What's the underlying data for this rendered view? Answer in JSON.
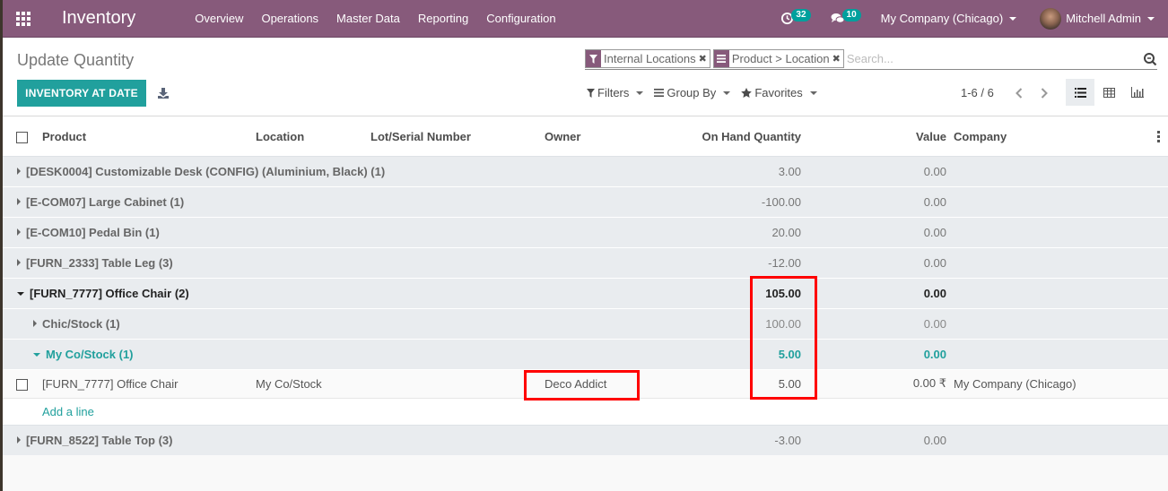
{
  "navbar": {
    "brand": "Inventory",
    "menu": [
      "Overview",
      "Operations",
      "Master Data",
      "Reporting",
      "Configuration"
    ],
    "activities_count": "32",
    "messages_count": "10",
    "company": "My Company (Chicago)",
    "user": "Mitchell Admin"
  },
  "control_panel": {
    "breadcrumb": "Update Quantity",
    "primary_button": "INVENTORY AT DATE",
    "facets": [
      {
        "type": "filter",
        "label": "Internal Locations"
      },
      {
        "type": "groupby",
        "label": "Product > Location"
      }
    ],
    "search_placeholder": "Search...",
    "filters_label": "Filters",
    "groupby_label": "Group By",
    "favorites_label": "Favorites",
    "pager": "1-6 / 6"
  },
  "table": {
    "columns": [
      "Product",
      "Location",
      "Lot/Serial Number",
      "Owner",
      "On Hand Quantity",
      "Value",
      "Company"
    ],
    "groups": [
      {
        "label": "[DESK0004] Customizable Desk (CONFIG) (Aluminium, Black) (1)",
        "qty": "3.00",
        "value": "0.00"
      },
      {
        "label": "[E-COM07] Large Cabinet (1)",
        "qty": "-100.00",
        "value": "0.00"
      },
      {
        "label": "[E-COM10] Pedal Bin (1)",
        "qty": "20.00",
        "value": "0.00"
      },
      {
        "label": "[FURN_2333] Table Leg (3)",
        "qty": "-12.00",
        "value": "0.00"
      },
      {
        "label": "[FURN_7777] Office Chair (2)",
        "qty": "105.00",
        "value": "0.00"
      }
    ],
    "subgroups": [
      {
        "label": "Chic/Stock (1)",
        "qty": "100.00",
        "value": "0.00"
      },
      {
        "label": "My Co/Stock (1)",
        "qty": "5.00",
        "value": "0.00"
      }
    ],
    "record": {
      "product": "[FURN_7777] Office Chair",
      "location": "My Co/Stock",
      "lot": "",
      "owner": "Deco Addict",
      "qty": "5.00",
      "value": "0.00 ₹",
      "company": "My Company (Chicago)"
    },
    "add_line": "Add a line",
    "last_group": {
      "label": "[FURN_8522] Table Top (3)",
      "qty": "-3.00",
      "value": "0.00"
    }
  },
  "colors": {
    "brand": "#875a7b",
    "accent": "#21a09d",
    "highlight": "#ff0000"
  }
}
